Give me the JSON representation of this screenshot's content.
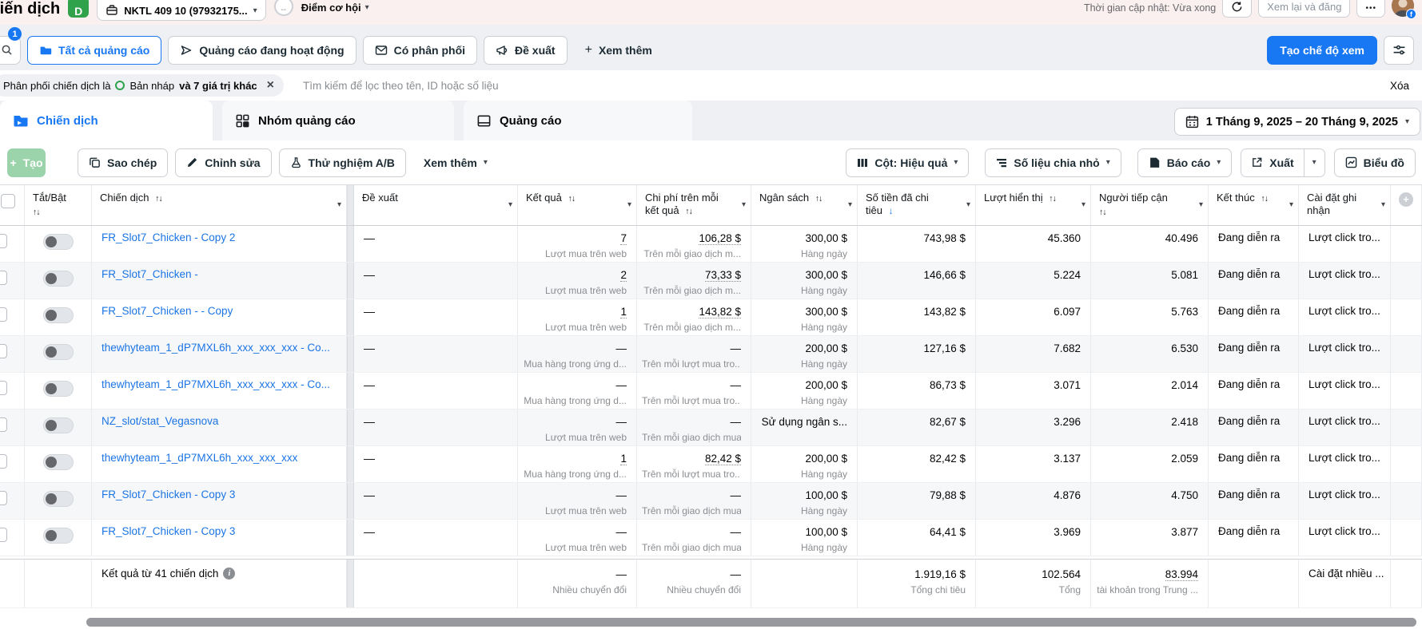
{
  "colors": {
    "primary_blue": "#1877f2",
    "link_blue": "#1b74e4",
    "green": "#31a24c",
    "pink_bar": "#fbf0f0",
    "gray_band": "#eef0f3"
  },
  "icons": {
    "caret": "▾",
    "sort": "↑↓",
    "sort_desc": "↓",
    "close": "×",
    "plus": "+",
    "more_dots": "•••",
    "score_dash": "--",
    "fb": "f",
    "info": "i"
  },
  "topbar": {
    "page_title": "Chiến dịch",
    "account_badge": "D",
    "account_selector": "NKTL 409 10 (97932175...",
    "score_value": "--",
    "score_label": "Điểm cơ hội",
    "updated_text": "Thời gian cập nhật: Vừa xong",
    "review_button": "Xem lại và đăng"
  },
  "filter_bar": {
    "search_badge": "1",
    "filters": [
      {
        "label": "Tất cả quảng cáo"
      },
      {
        "label": "Quảng cáo đang hoạt động"
      },
      {
        "label": "Có phân phối"
      },
      {
        "label": "Đề xuất"
      }
    ],
    "see_more": "Xem thêm",
    "create_view_button": "Tạo chế độ xem"
  },
  "filter_chip": {
    "prefix": "Phân phối chiến dịch là",
    "value": "Bản nháp",
    "suffix": "và 7 giá trị khác"
  },
  "search_placeholder": "Tìm kiếm để lọc theo tên, ID hoặc số liệu",
  "clear_label": "Xóa",
  "tabs": [
    {
      "label": "Chiến dịch"
    },
    {
      "label": "Nhóm quảng cáo"
    },
    {
      "label": "Quảng cáo"
    }
  ],
  "date_range": "1 Tháng 9, 2025 – 20 Tháng 9, 2025",
  "toolbar": {
    "create": "Tạo",
    "duplicate": "Sao chép",
    "edit": "Chỉnh sửa",
    "ab_test": "Thử nghiệm A/B",
    "see_more": "Xem thêm",
    "columns": "Cột: Hiệu quả",
    "breakdown": "Số liệu chia nhỏ",
    "reports": "Báo cáo",
    "export": "Xuất",
    "charts": "Biểu đồ"
  },
  "table": {
    "columns": {
      "toggle": "Tắt/Bật",
      "campaign": "Chiến dịch",
      "suggestion": "Đề xuất",
      "result": "Kết quả",
      "cost": "Chi phí trên mỗi kết quả",
      "budget": "Ngân sách",
      "spent": "Số tiền đã chi tiêu",
      "impressions": "Lượt hiển thị",
      "reach": "Người tiếp cận",
      "end": "Kết thúc",
      "attribution": "Cài đặt ghi nhận"
    },
    "rows": [
      {
        "name": "FR_Slot7_Chicken - Copy 2",
        "suggestion": "—",
        "result": "7",
        "result_label": "Lượt mua trên web",
        "cost": "106,28 $",
        "cost_label": "Trên mỗi giao dịch m...",
        "budget": "300,00 $",
        "budget_label": "Hàng ngày",
        "spent": "743,98 $",
        "impressions": "45.360",
        "reach": "40.496",
        "end": "Đang diễn ra",
        "attribution": "Lượt click tro..."
      },
      {
        "name": "FR_Slot7_Chicken -",
        "suggestion": "—",
        "result": "2",
        "result_label": "Lượt mua trên web",
        "cost": "73,33 $",
        "cost_label": "Trên mỗi giao dịch m...",
        "budget": "300,00 $",
        "budget_label": "Hàng ngày",
        "spent": "146,66 $",
        "impressions": "5.224",
        "reach": "5.081",
        "end": "Đang diễn ra",
        "attribution": "Lượt click tro..."
      },
      {
        "name": "FR_Slot7_Chicken - - Copy",
        "suggestion": "—",
        "result": "1",
        "result_label": "Lượt mua trên web",
        "cost": "143,82 $",
        "cost_label": "Trên mỗi giao dịch m...",
        "budget": "300,00 $",
        "budget_label": "Hàng ngày",
        "spent": "143,82 $",
        "impressions": "6.097",
        "reach": "5.763",
        "end": "Đang diễn ra",
        "attribution": "Lượt click tro..."
      },
      {
        "name": "thewhyteam_1_dP7MXL6h_xxx_xxx_xxx - Co...",
        "suggestion": "—",
        "result": "—",
        "result_label": "Mua hàng trong ứng d...",
        "cost": "—",
        "cost_label": "Trên mỗi lượt mua tro...",
        "budget": "200,00 $",
        "budget_label": "Hàng ngày",
        "spent": "127,16 $",
        "impressions": "7.682",
        "reach": "6.530",
        "end": "Đang diễn ra",
        "attribution": "Lượt click tro..."
      },
      {
        "name": "thewhyteam_1_dP7MXL6h_xxx_xxx_xxx - Co...",
        "suggestion": "—",
        "result": "—",
        "result_label": "Mua hàng trong ứng d...",
        "cost": "—",
        "cost_label": "Trên mỗi lượt mua tro...",
        "budget": "200,00 $",
        "budget_label": "Hàng ngày",
        "spent": "86,73 $",
        "impressions": "3.071",
        "reach": "2.014",
        "end": "Đang diễn ra",
        "attribution": "Lượt click tro..."
      },
      {
        "name": "NZ_slot/stat_Vegasnova",
        "suggestion": "—",
        "result": "—",
        "result_label": "Lượt mua trên web",
        "cost": "—",
        "cost_label": "Trên mỗi giao dịch mua",
        "budget": "Sử dụng ngân s...",
        "budget_label": "",
        "spent": "82,67 $",
        "impressions": "3.296",
        "reach": "2.418",
        "end": "Đang diễn ra",
        "attribution": "Lượt click tro..."
      },
      {
        "name": "thewhyteam_1_dP7MXL6h_xxx_xxx_xxx",
        "suggestion": "—",
        "result": "1",
        "result_label": "Mua hàng trong ứng d...",
        "cost": "82,42 $",
        "cost_label": "Trên mỗi lượt mua tro...",
        "budget": "200,00 $",
        "budget_label": "Hàng ngày",
        "spent": "82,42 $",
        "impressions": "3.137",
        "reach": "2.059",
        "end": "Đang diễn ra",
        "attribution": "Lượt click tro..."
      },
      {
        "name": "FR_Slot7_Chicken - Copy 3",
        "suggestion": "—",
        "result": "—",
        "result_label": "Lượt mua trên web",
        "cost": "—",
        "cost_label": "Trên mỗi giao dịch mua",
        "budget": "100,00 $",
        "budget_label": "Hàng ngày",
        "spent": "79,88 $",
        "impressions": "4.876",
        "reach": "4.750",
        "end": "Đang diễn ra",
        "attribution": "Lượt click tro..."
      },
      {
        "name": "FR_Slot7_Chicken - Copy 3",
        "suggestion": "—",
        "result": "—",
        "result_label": "Lượt mua trên web",
        "cost": "—",
        "cost_label": "Trên mỗi giao dịch mua",
        "budget": "100,00 $",
        "budget_label": "Hàng ngày",
        "spent": "64,41 $",
        "impressions": "3.969",
        "reach": "3.877",
        "end": "Đang diễn ra",
        "attribution": "Lượt click tro..."
      }
    ],
    "footer": {
      "label": "Kết quả từ 41 chiến dịch",
      "result": "—",
      "result_label": "Nhiều chuyển đổi",
      "cost": "—",
      "cost_label": "Nhiều chuyển đổi",
      "spent": "1.919,16 $",
      "spent_label": "Tổng chi tiêu",
      "impressions": "102.564",
      "impressions_label": "Tổng",
      "reach": "83.994",
      "reach_label": "tài khoản trong Trung ...",
      "attribution": "Cài đặt nhiều ..."
    }
  }
}
